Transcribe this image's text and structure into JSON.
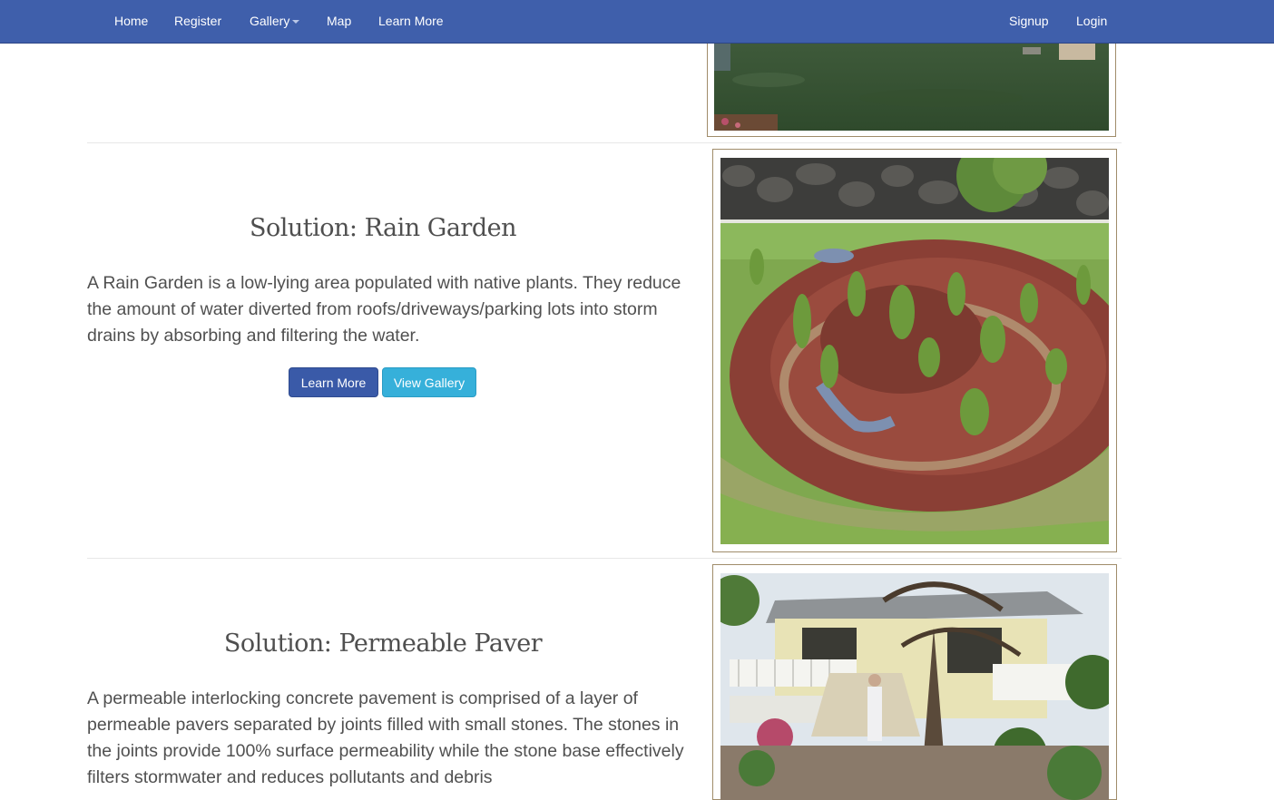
{
  "nav": {
    "home": "Home",
    "register": "Register",
    "gallery": "Gallery",
    "map": "Map",
    "learn_more": "Learn More",
    "signup": "Signup",
    "login": "Login"
  },
  "sections": {
    "rain_garden": {
      "title": "Solution: Rain Garden",
      "text": "A Rain Garden is a low-lying area populated with native plants. They reduce the amount of water diverted from roofs/driveways/parking lots into storm drains by absorbing and filtering the water.",
      "learn_more": "Learn More",
      "view_gallery": "View Gallery"
    },
    "permeable_paver": {
      "title": "Solution: Permeable Paver",
      "text": "A permeable interlocking concrete pavement is comprised of a layer of permeable pavers separated by joints filled with small stones. The stones in the joints provide 100% surface permeability while the stone base effectively filters stormwater and reduces pollutants and debris"
    }
  },
  "colors": {
    "navbar": "#3f5fab",
    "primary_button": "#3a5aa8",
    "info_button": "#36b0da",
    "frame_border": "#a08c6a"
  }
}
